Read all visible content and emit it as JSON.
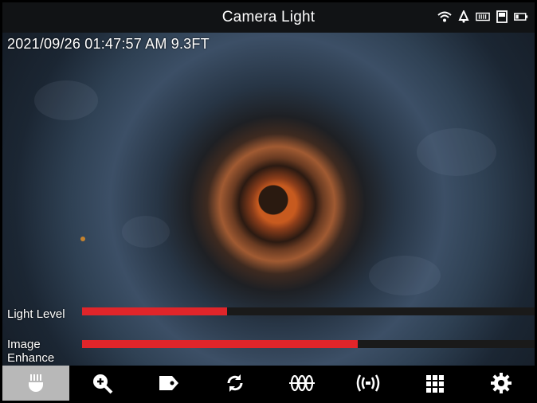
{
  "header": {
    "title": "Camera Light"
  },
  "status_icons": [
    "wifi-icon",
    "alert-bell-icon",
    "memory-card-icon",
    "save-icon",
    "battery-icon"
  ],
  "overlay": {
    "timestamp": "2021/09/26 01:47:57 AM 9.3FT"
  },
  "sliders": {
    "light_level": {
      "label": "Light Level",
      "value": 0.32,
      "color": "#e0252a"
    },
    "image_enhance": {
      "label": "Image\nEnhance",
      "value": 0.61,
      "color": "#e0252a"
    }
  },
  "toolbar": {
    "items": [
      {
        "name": "camera-light-icon",
        "active": true
      },
      {
        "name": "zoom-in-icon",
        "active": false
      },
      {
        "name": "tag-icon",
        "active": false
      },
      {
        "name": "rotate-icon",
        "active": false
      },
      {
        "name": "distance-meter-icon",
        "active": false
      },
      {
        "name": "locator-signal-icon",
        "active": false
      },
      {
        "name": "grid-icon",
        "active": false
      },
      {
        "name": "settings-gear-icon",
        "active": false
      }
    ]
  }
}
